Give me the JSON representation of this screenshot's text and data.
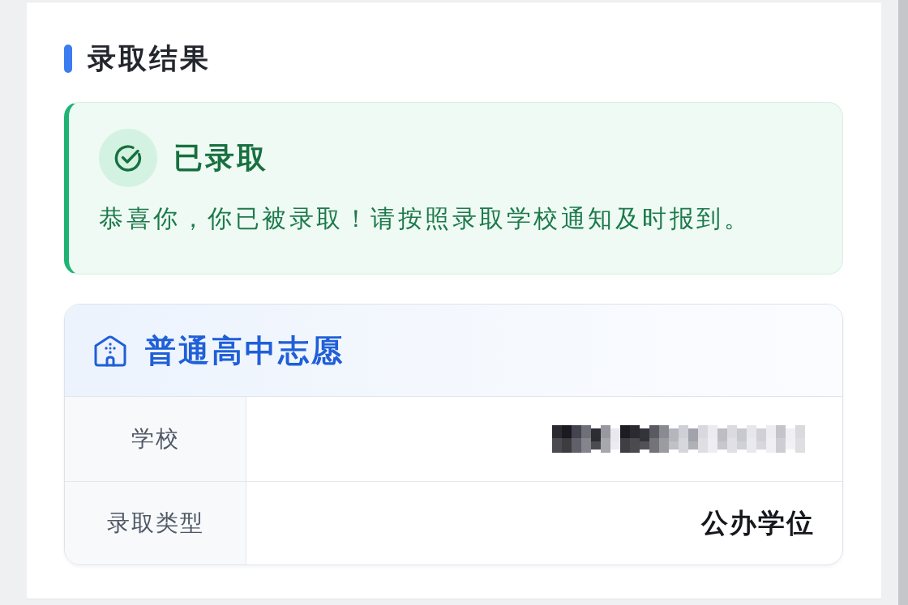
{
  "section": {
    "title": "录取结果"
  },
  "status": {
    "kind": "admitted",
    "title": "已录取",
    "message": "恭喜你，你已被录取！请按照录取学校通知及时报到。"
  },
  "volunteer": {
    "title": "普通高中志愿",
    "rows": [
      {
        "label": "学校",
        "kind": "redacted"
      },
      {
        "label": "录取类型",
        "kind": "text",
        "value": "公办学位"
      }
    ]
  }
}
